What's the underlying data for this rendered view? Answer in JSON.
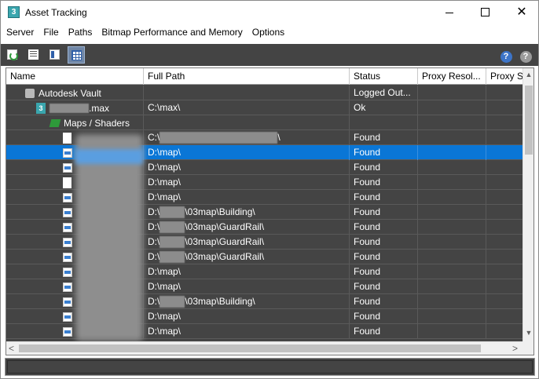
{
  "window": {
    "title": "Asset Tracking",
    "app_icon_glyph": "3",
    "controls": {
      "minimize": "minimize-icon",
      "maximize": "maximize-icon",
      "close_glyph": "✕"
    }
  },
  "menu": [
    "Server",
    "File",
    "Paths",
    "Bitmap Performance and Memory",
    "Options"
  ],
  "toolbar": {
    "buttons": [
      "refresh-icon",
      "list-view-icon",
      "detail-view-icon",
      "grid-view-icon"
    ],
    "active": "grid-view-icon",
    "help_glyph": "?",
    "colors": {
      "background": "#444444",
      "active": "#6f86a6"
    }
  },
  "table": {
    "columns": [
      "Name",
      "Full Path",
      "Status",
      "Proxy Resol...",
      "Proxy S"
    ],
    "rows": [
      {
        "name": "Autodesk Vault",
        "icon": "vault-icon",
        "path": "",
        "status": "Logged Out...",
        "selected": false
      },
      {
        "name": ".max",
        "icon": "max-file-icon",
        "path": "C:\\max\\",
        "status": "Ok",
        "selected": false
      },
      {
        "name": "Maps / Shaders",
        "icon": "maps-icon",
        "path": "",
        "status": "",
        "selected": false
      },
      {
        "name": "",
        "icon": "file-icon",
        "path": "C:\\",
        "path_tail": "\\",
        "status": "Found",
        "selected": false
      },
      {
        "name": "",
        "icon": "bitmap-icon",
        "path": "D:\\map\\",
        "status": "Found",
        "selected": true
      },
      {
        "name": "",
        "icon": "bitmap-icon",
        "path": "D:\\map\\",
        "status": "Found",
        "selected": false
      },
      {
        "name": "",
        "icon": "psd-icon",
        "path": "D:\\map\\",
        "status": "Found",
        "selected": false
      },
      {
        "name": "",
        "icon": "bitmap-icon",
        "path": "D:\\map\\",
        "status": "Found",
        "selected": false
      },
      {
        "name": "",
        "icon": "bitmap-icon",
        "path": "D:\\",
        "path_tail": "\\03map\\Building\\",
        "status": "Found",
        "selected": false
      },
      {
        "name": "",
        "icon": "bitmap-icon",
        "path": "D:\\",
        "path_tail": "\\03map\\GuardRail\\",
        "status": "Found",
        "selected": false
      },
      {
        "name": "",
        "icon": "bitmap-icon",
        "path": "D:\\",
        "path_tail": "\\03map\\GuardRail\\",
        "status": "Found",
        "selected": false
      },
      {
        "name": "",
        "icon": "bitmap-icon",
        "path": "D:\\",
        "path_tail": "\\03map\\GuardRail\\",
        "status": "Found",
        "selected": false
      },
      {
        "name": "",
        "icon": "bitmap-icon",
        "path": "D:\\map\\",
        "status": "Found",
        "selected": false
      },
      {
        "name": "",
        "icon": "bitmap-icon",
        "path": "D:\\map\\",
        "status": "Found",
        "selected": false
      },
      {
        "name": "",
        "icon": "bitmap-icon",
        "path": "D:\\",
        "path_tail": "\\03map\\Building\\",
        "status": "Found",
        "selected": false
      },
      {
        "name": "",
        "icon": "bitmap-icon",
        "path": "D:\\map\\",
        "status": "Found",
        "selected": false
      },
      {
        "name": "",
        "icon": "bitmap-icon",
        "path": "D:\\map\\",
        "status": "Found",
        "selected": false
      }
    ],
    "colors": {
      "row_bg": "#444444",
      "selected_bg": "#0a76d6",
      "text": "#ffffff"
    }
  },
  "scrollbars": {
    "left_arrow": "<",
    "right_arrow": ">",
    "up_arrow": "▲",
    "down_arrow": "▼"
  },
  "statusbar": {
    "text": ""
  }
}
